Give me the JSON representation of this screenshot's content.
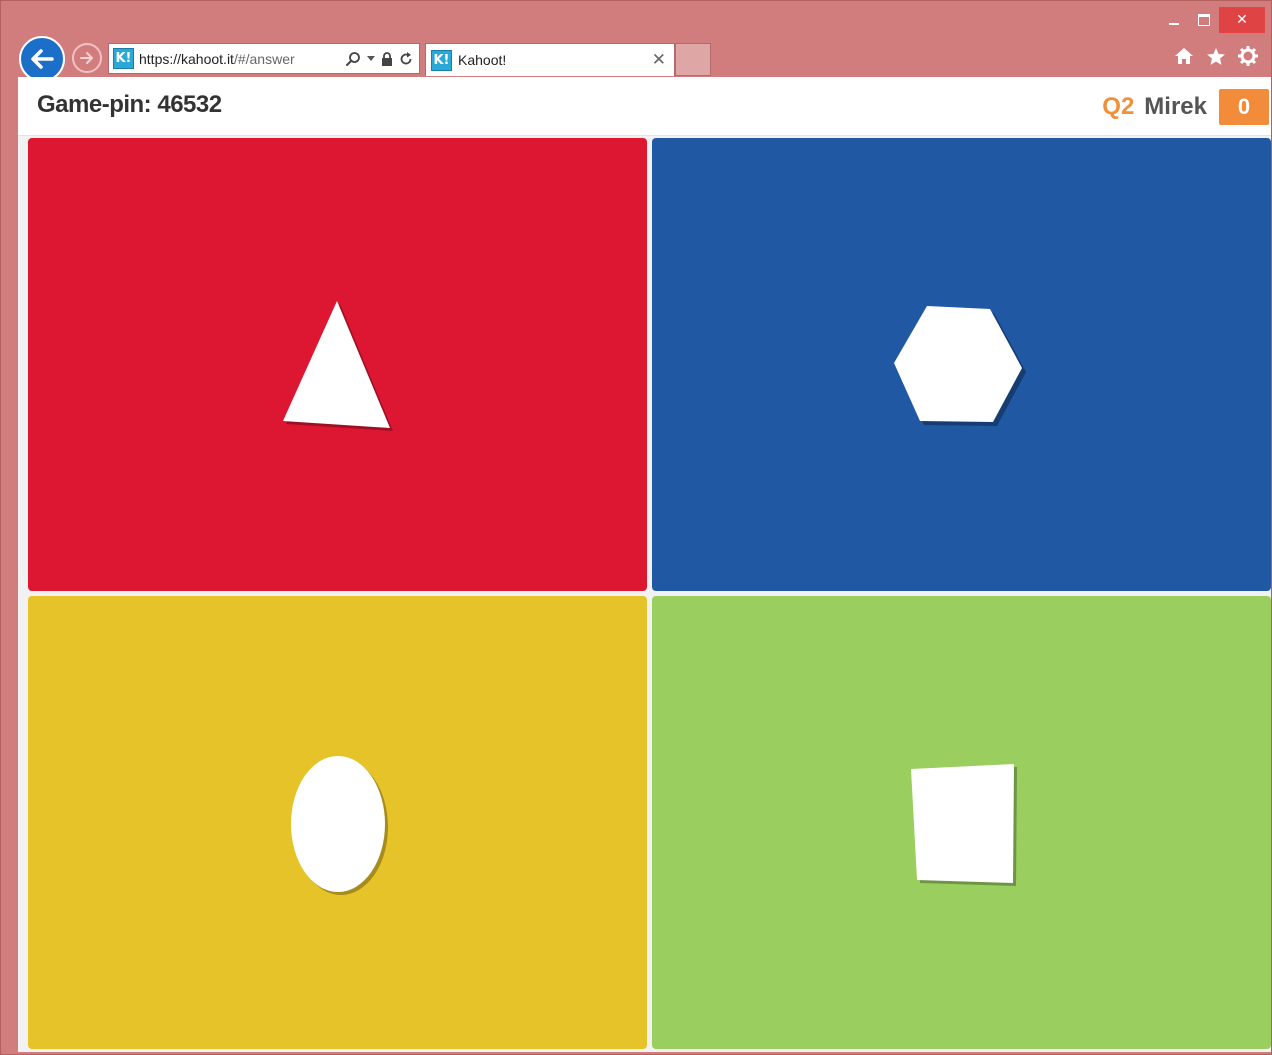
{
  "browser": {
    "url_main": "https://kahoot.it",
    "url_rest": "/#/answer",
    "tab_title": "Kahoot!",
    "favicon_text": "K!",
    "chrome_color": "#d27d7d"
  },
  "page": {
    "game_pin": "Game-pin: 46532",
    "question": "Q2",
    "player_name": "Mirek",
    "score": "0"
  },
  "answers": [
    {
      "shape": "triangle",
      "color": "#dd1631"
    },
    {
      "shape": "hexagon",
      "color": "#2058a4"
    },
    {
      "shape": "circle",
      "color": "#e6c329"
    },
    {
      "shape": "square",
      "color": "#9ace5f"
    }
  ]
}
